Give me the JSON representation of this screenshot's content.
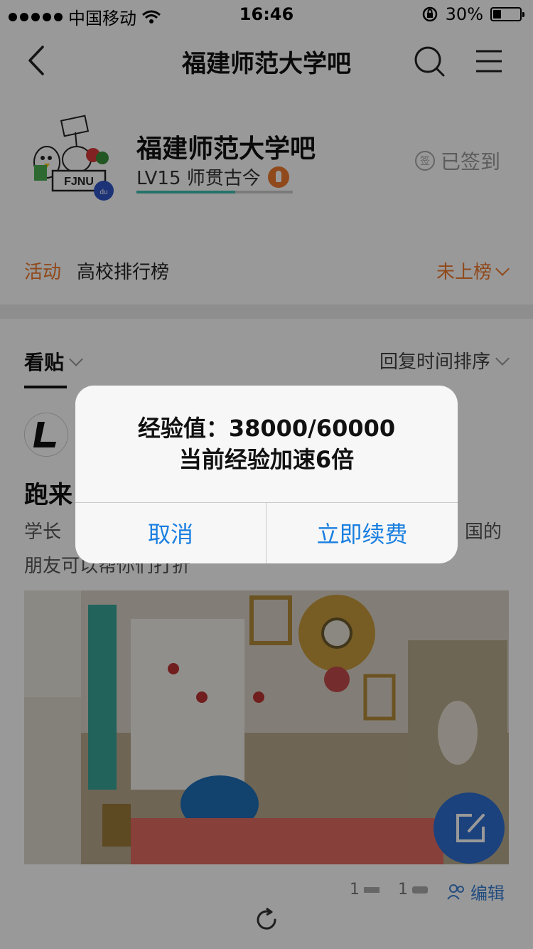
{
  "status_bar": {
    "carrier": "中国移动",
    "time": "16:46",
    "battery": "30%",
    "battery_level": 0.3
  },
  "nav": {
    "title": "福建师范大学吧",
    "back_icon": "chevron-left-icon",
    "search_icon": "search-icon",
    "menu_icon": "menu-icon"
  },
  "forum": {
    "name": "福建师范大学吧",
    "level": "LV15 师贯古今",
    "level_progress": 0.633,
    "signed_label": "已签到",
    "signed_icon_text": "签",
    "avatar_text": "FJNU"
  },
  "activity": {
    "tag": "活动",
    "text": "高校排行榜",
    "rank": "未上榜"
  },
  "tabs": {
    "left": "看贴",
    "sort": "回复时间排序"
  },
  "post": {
    "title": "跑来",
    "body_line1_left": "学长",
    "body_line1_right": "国的",
    "body_line2": "朋友可以帮你们打折",
    "meta_count1": "1",
    "meta_count2": "1",
    "edit_label": "编辑"
  },
  "dialog": {
    "line1": "经验值：38000/60000",
    "line2": "当前经验加速6倍",
    "cancel": "取消",
    "confirm": "立即续费"
  },
  "colors": {
    "accent_orange": "#f07a2e",
    "link_blue": "#1a7fe0",
    "fab_blue": "#2d6ecf",
    "progress_teal": "#3dbfb0"
  }
}
